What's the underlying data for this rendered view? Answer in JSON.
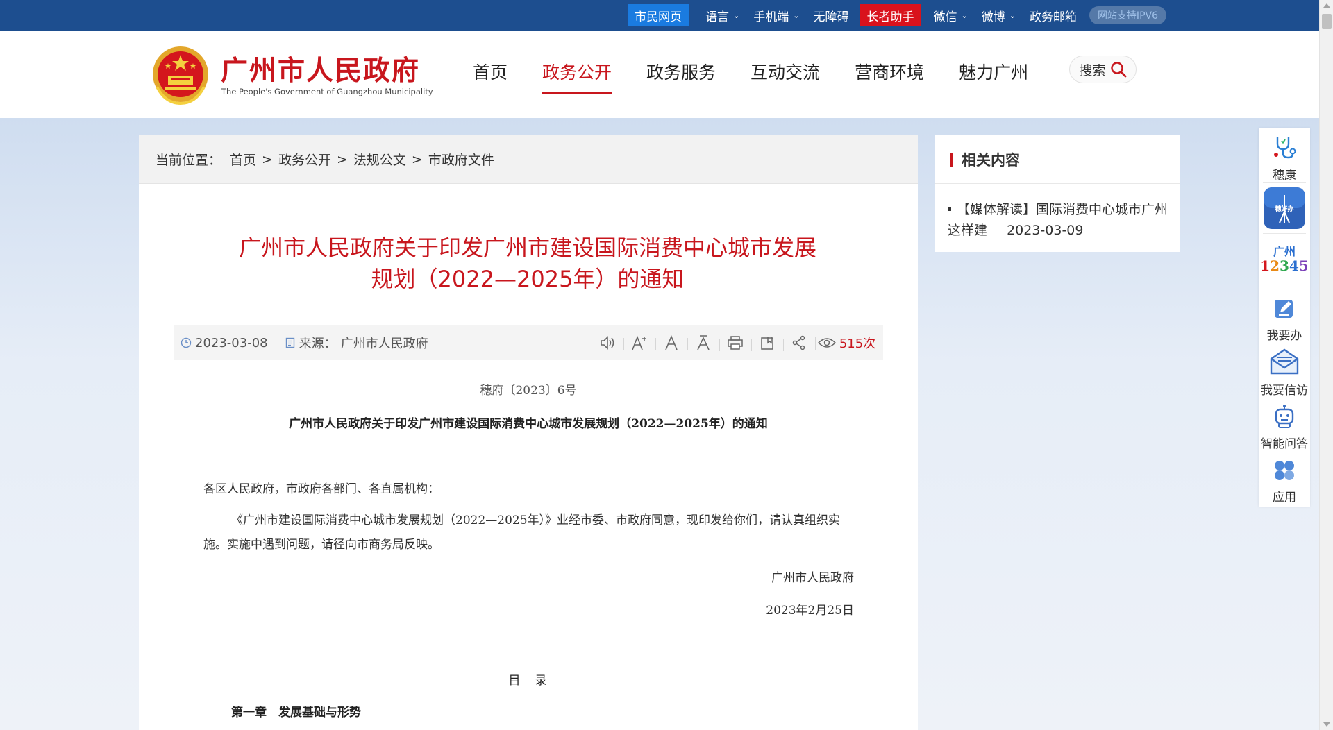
{
  "topbar": {
    "citizen_web": "市民网页",
    "language": "语言",
    "mobile": "手机端",
    "accessibility": "无障碍",
    "elder_assist": "长者助手",
    "wechat": "微信",
    "weibo": "微博",
    "gov_mail": "政务邮箱",
    "ipv6": "网站支持IPV6"
  },
  "header": {
    "site_title": "广州市人民政府",
    "site_subtitle": "The People's Government of Guangzhou Municipality",
    "nav": [
      "首页",
      "政务公开",
      "政务服务",
      "互动交流",
      "营商环境",
      "魅力广州"
    ],
    "active_nav": "政务公开",
    "search_label": "搜索"
  },
  "breadcrumb": {
    "prefix": "当前位置：",
    "items": [
      "首页",
      "政务公开",
      "法规公文",
      "市政府文件"
    ],
    "separator": ">"
  },
  "article": {
    "title_line1": "广州市人民政府关于印发广州市建设国际消费中心城市发展",
    "title_line2": "规划（2022—2025年）的通知",
    "date": "2023-03-08",
    "source_label": "来源：",
    "source": "广州市人民政府",
    "views": "515次",
    "doc_no": "穗府〔2023〕6号",
    "doc_heading": "广州市人民政府关于印发广州市建设国际消费中心城市发展规划（2022—2025年）的通知",
    "salutation": "各区人民政府，市政府各部门、各直属机构：",
    "paragraph": "《广州市建设国际消费中心城市发展规划（2022—2025年）》业经市委、市政府同意，现印发给你们，请认真组织实施。实施中遇到问题，请径向市商务局反映。",
    "signer": "广州市人民政府",
    "sign_date": "2023年2月25日",
    "toc_title": "目　录",
    "toc_first": "第一章　发展基础与形势"
  },
  "related": {
    "heading": "相关内容",
    "item_text": "【媒体解读】国际消费中心城市广州这样建",
    "item_date": "2023-03-09"
  },
  "floatbar": {
    "items": [
      "穗康",
      "穗好办",
      "广州12345",
      "我要办",
      "我要信访",
      "智能问答",
      "应用"
    ]
  },
  "colors": {
    "brand_red": "#c8161d",
    "topbar_blue": "#1d4e8f",
    "citizen_blue": "#1a7be0"
  }
}
